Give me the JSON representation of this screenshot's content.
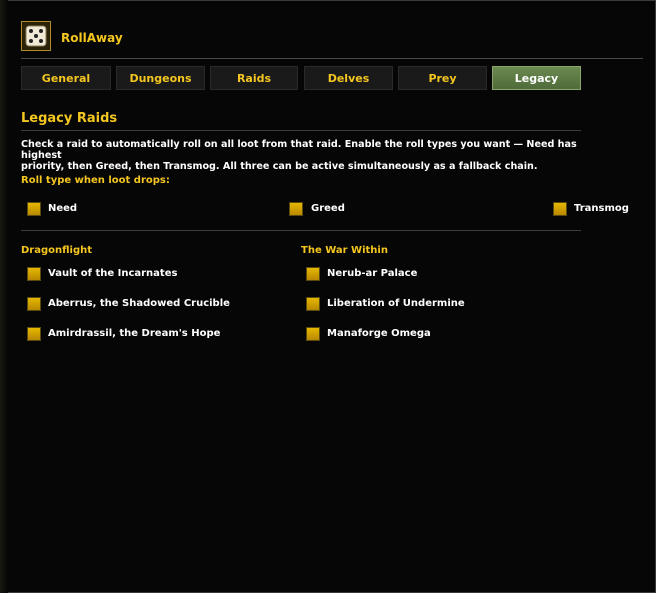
{
  "app": {
    "title": "RollAway",
    "icon": "dice-icon"
  },
  "tabs": [
    {
      "label": "General",
      "active": false
    },
    {
      "label": "Dungeons",
      "active": false
    },
    {
      "label": "Raids",
      "active": false
    },
    {
      "label": "Delves",
      "active": false
    },
    {
      "label": "Prey",
      "active": false
    },
    {
      "label": "Legacy",
      "active": true
    }
  ],
  "section": {
    "title": "Legacy Raids",
    "description": "Check a raid to automatically roll on all loot from that raid. Enable the roll types you want — Need has highest\npriority, then Greed, then Transmog. All three can be active simultaneously as a fallback chain."
  },
  "roll_types": {
    "label": "Roll type when loot drops:",
    "options": [
      {
        "label": "Need",
        "checked": true
      },
      {
        "label": "Greed",
        "checked": true
      },
      {
        "label": "Transmog",
        "checked": true
      }
    ]
  },
  "groups": [
    {
      "title": "Dragonflight",
      "raids": [
        {
          "label": "Vault of the Incarnates",
          "checked": true
        },
        {
          "label": "Aberrus, the Shadowed Crucible",
          "checked": true
        },
        {
          "label": "Amirdrassil, the Dream's Hope",
          "checked": true
        }
      ]
    },
    {
      "title": "The War Within",
      "raids": [
        {
          "label": "Nerub-ar Palace",
          "checked": true
        },
        {
          "label": "Liberation of Undermine",
          "checked": true
        },
        {
          "label": "Manaforge Omega",
          "checked": true
        }
      ]
    }
  ],
  "colors": {
    "accent": "#f4c620",
    "checkbox": "#d4a800",
    "active_tab": "#5f7c47",
    "background": "#060606"
  }
}
